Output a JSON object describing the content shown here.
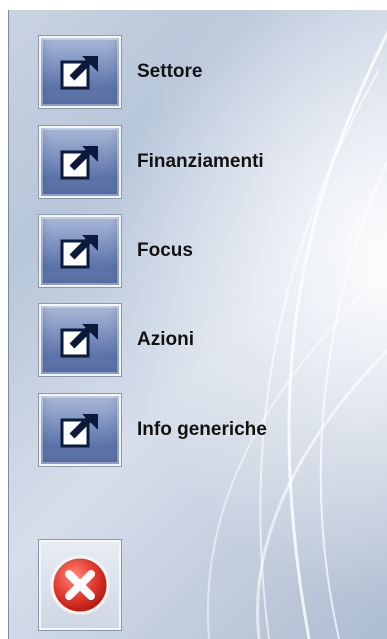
{
  "menu": {
    "items": [
      {
        "label": "Settore",
        "icon": "external-link-arrow-icon"
      },
      {
        "label": "Finanziamenti",
        "icon": "external-link-arrow-icon"
      },
      {
        "label": "Focus",
        "icon": "external-link-arrow-icon"
      },
      {
        "label": "Azioni",
        "icon": "external-link-arrow-icon"
      },
      {
        "label": "Info generiche",
        "icon": "external-link-arrow-icon"
      }
    ]
  },
  "close": {
    "icon": "close-x-icon",
    "color": "#d9362b"
  },
  "colors": {
    "button_blue": "#5a72a8",
    "panel_bg": "#c9d3e2"
  }
}
